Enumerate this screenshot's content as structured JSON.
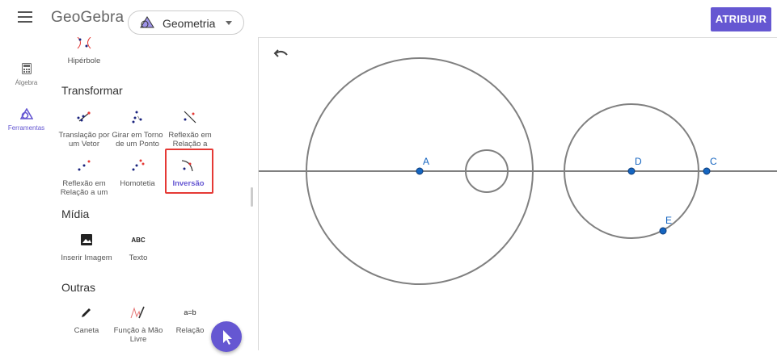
{
  "header": {
    "brand": "GeoGebra",
    "app_name": "Geometria",
    "assign_label": "ATRIBUIR",
    "menu_icon": "hamburger-menu-icon",
    "accent": "#6557d2"
  },
  "rail": {
    "items": [
      {
        "label": "Álgebra",
        "icon": "calculator-icon",
        "active": false
      },
      {
        "label": "Ferramentas",
        "icon": "tools-icon",
        "active": true
      }
    ]
  },
  "tools_panel": {
    "top_partial_tool": "Hipérbole",
    "sections": [
      {
        "title": "Transformar",
        "tools": [
          {
            "label": "Translação por um Vetor",
            "icon": "translate-by-vector-icon"
          },
          {
            "label": "Girar em Torno de um Ponto",
            "icon": "rotate-around-point-icon"
          },
          {
            "label": "Reflexão em Relação a",
            "icon": "reflect-about-line-icon"
          },
          {
            "label": "Reflexão em Relação a um",
            "icon": "reflect-about-point-icon"
          },
          {
            "label": "Homotetia",
            "icon": "dilate-icon"
          },
          {
            "label": "Inversão",
            "icon": "invert-icon",
            "selected": true
          }
        ]
      },
      {
        "title": "Mídia",
        "tools": [
          {
            "label": "Inserir Imagem",
            "icon": "image-icon"
          },
          {
            "label": "Texto",
            "icon": "text-icon",
            "glyph": "ABC"
          }
        ]
      },
      {
        "title": "Outras",
        "tools": [
          {
            "label": "Caneta",
            "icon": "pen-icon"
          },
          {
            "label": "Função à Mão Livre",
            "icon": "freehand-function-icon"
          },
          {
            "label": "Relação",
            "icon": "relation-icon",
            "glyph": "a=b"
          }
        ]
      }
    ]
  },
  "graphics": {
    "points": [
      {
        "name": "A"
      },
      {
        "name": "D"
      },
      {
        "name": "C"
      },
      {
        "name": "E"
      }
    ],
    "undo_icon": "undo-icon",
    "point_color": "#1565c0",
    "curve_color": "#808080"
  },
  "fab_icon": "cursor-arrow-icon"
}
